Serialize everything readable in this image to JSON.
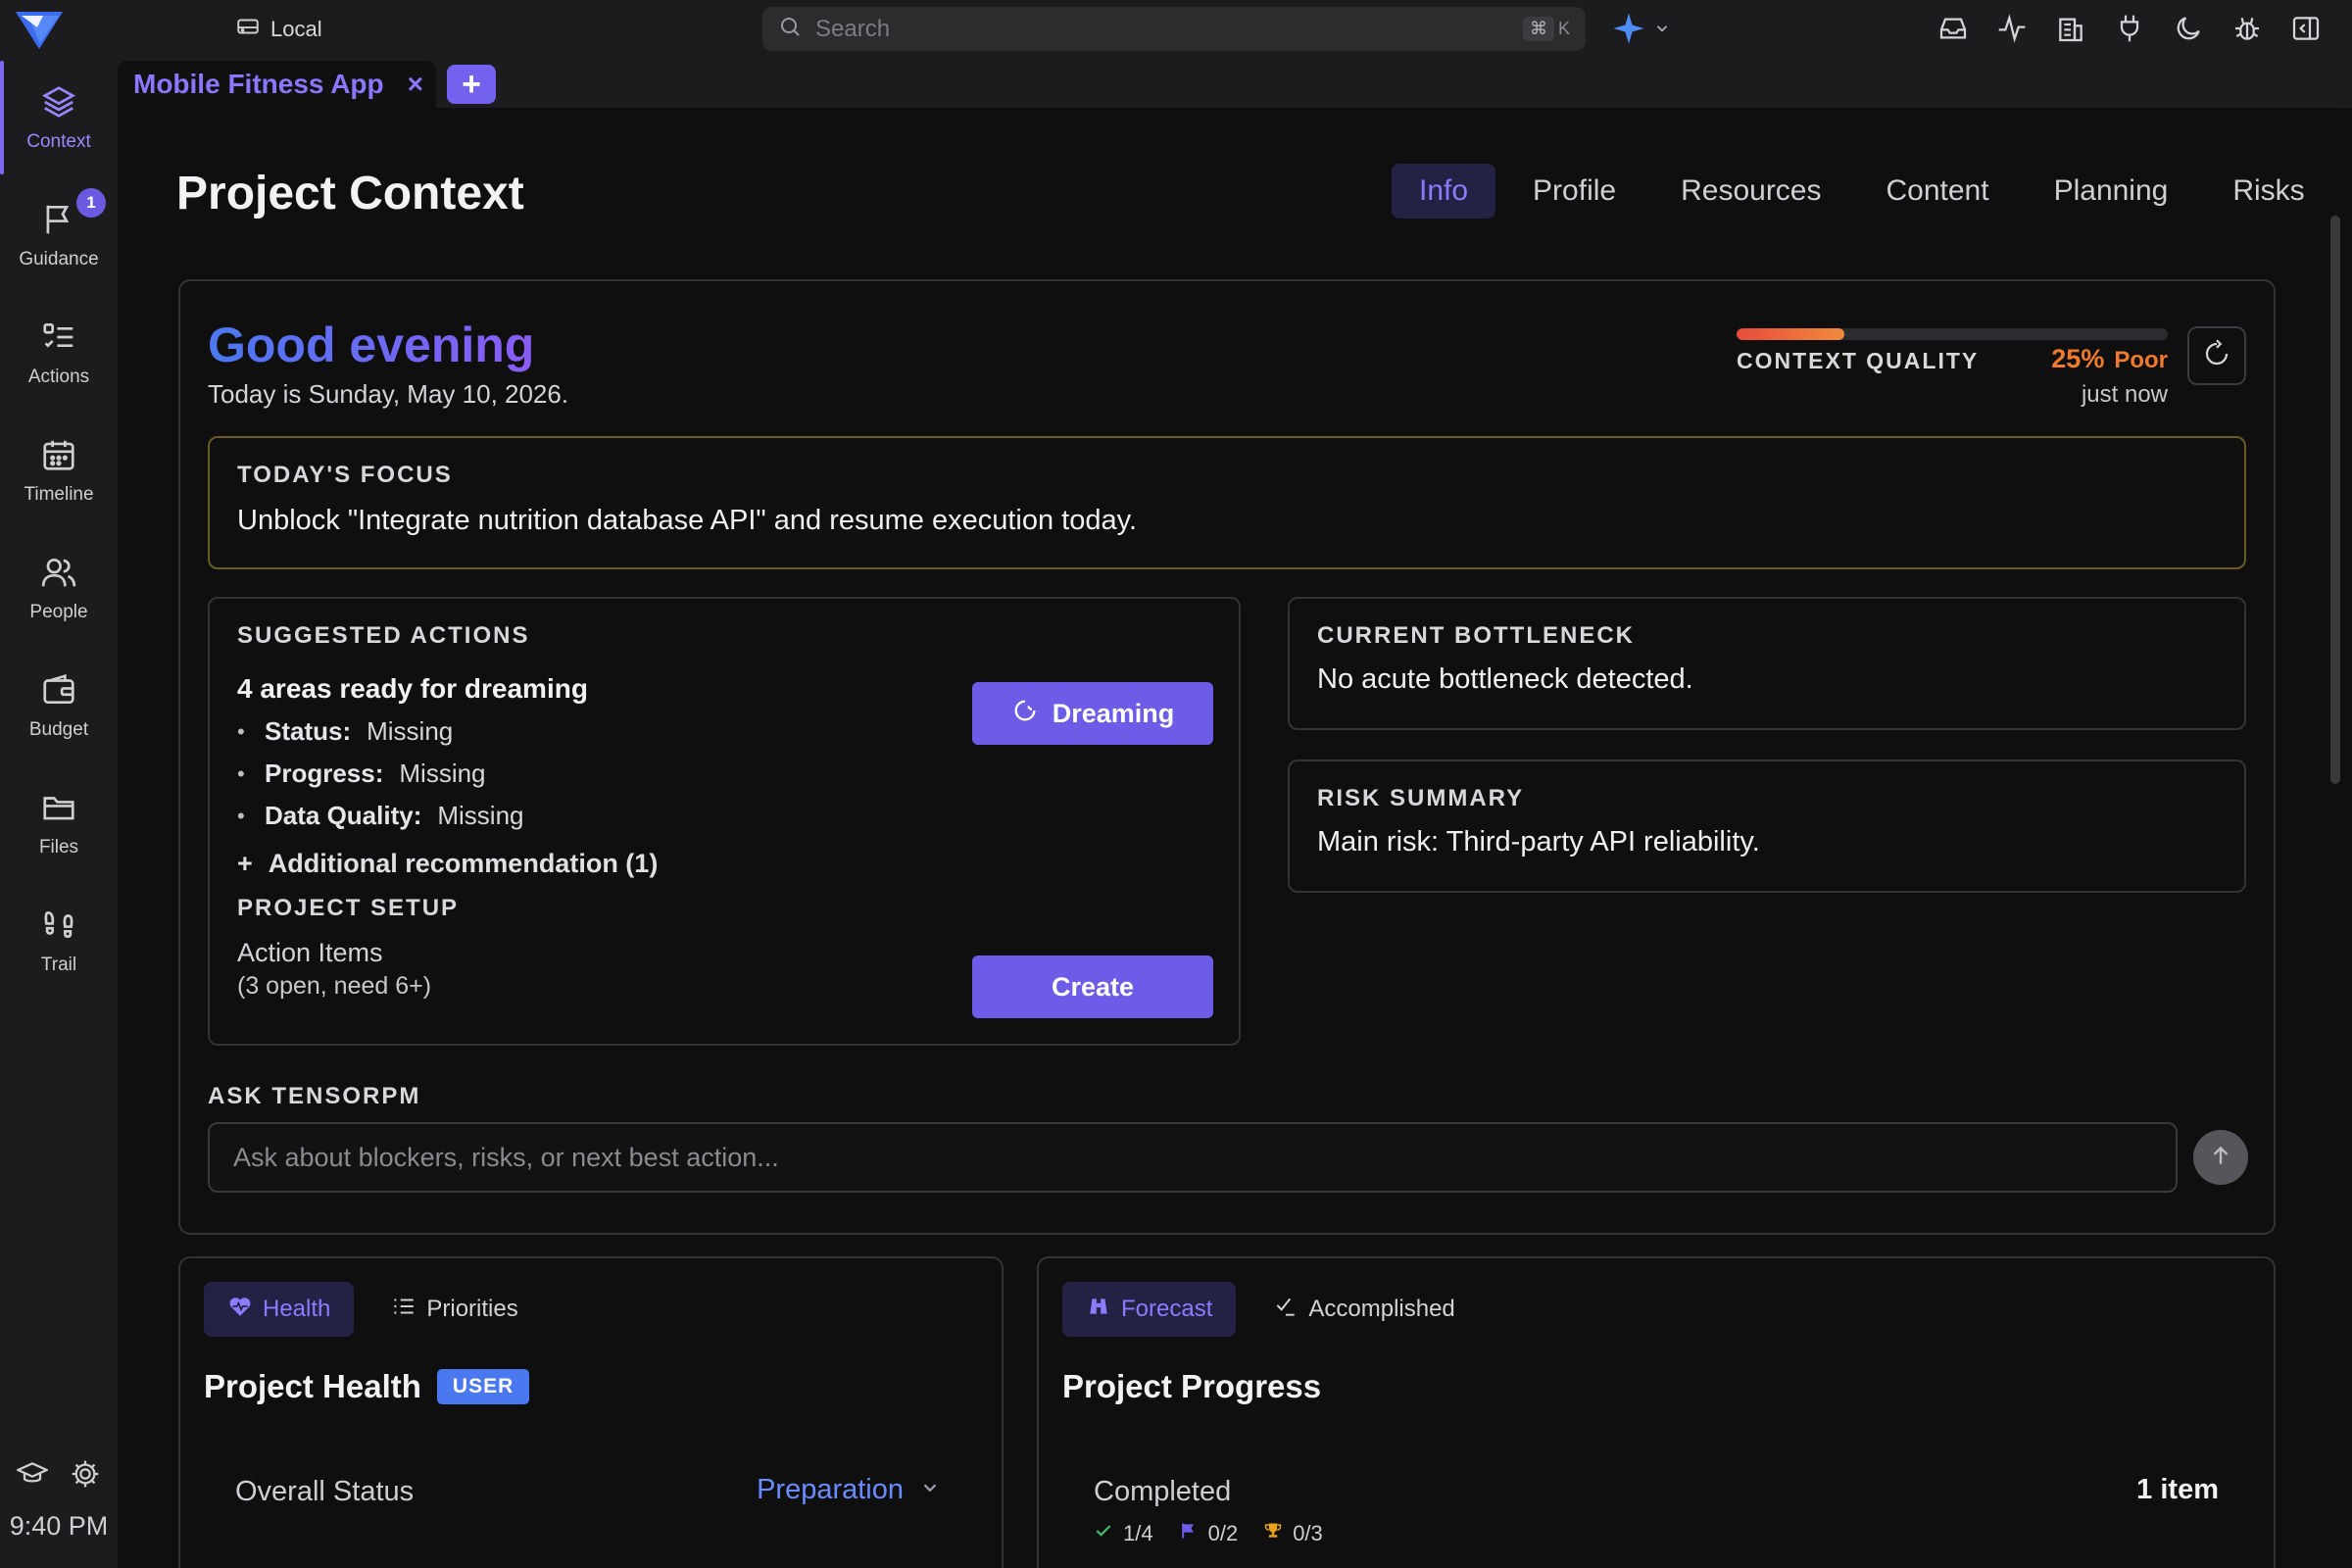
{
  "topbar": {
    "workspace": "Local",
    "search_placeholder": "Search",
    "shortcut_cmd": "⌘",
    "shortcut_key": "K"
  },
  "sidebar": {
    "items": [
      {
        "label": "Context",
        "icon": "layers-icon"
      },
      {
        "label": "Guidance",
        "icon": "flag-icon",
        "badge": "1"
      },
      {
        "label": "Actions",
        "icon": "checklist-icon"
      },
      {
        "label": "Timeline",
        "icon": "calendar-icon"
      },
      {
        "label": "People",
        "icon": "users-icon"
      },
      {
        "label": "Budget",
        "icon": "wallet-icon"
      },
      {
        "label": "Files",
        "icon": "folder-icon"
      },
      {
        "label": "Trail",
        "icon": "footprints-icon"
      }
    ],
    "time": "9:40 PM"
  },
  "tab": {
    "name": "Mobile Fitness App",
    "close": "×",
    "add": "+"
  },
  "header": {
    "title": "Project Context",
    "subtabs": [
      "Info",
      "Profile",
      "Resources",
      "Content",
      "Planning",
      "Risks"
    ]
  },
  "overview": {
    "greeting": "Good evening",
    "today": "Today is Sunday, May 10, 2026.",
    "context_quality": {
      "label": "CONTEXT QUALITY",
      "value": "25%",
      "level": 0.25,
      "rating": "Poor",
      "updated": "just now"
    },
    "focus": {
      "label": "TODAY'S FOCUS",
      "text": "Unblock \"Integrate nutrition database API\" and resume execution today."
    },
    "suggested": {
      "label": "SUGGESTED ACTIONS",
      "heading": "4 areas ready for dreaming",
      "items": [
        {
          "key": "Status:",
          "value": "Missing"
        },
        {
          "key": "Progress:",
          "value": "Missing"
        },
        {
          "key": "Data Quality:",
          "value": "Missing"
        }
      ],
      "dream_button": "Dreaming",
      "additional": "Additional recommendation (1)",
      "setup_label": "PROJECT SETUP",
      "setup_text": "Action Items",
      "setup_sub": "(3 open, need 6+)",
      "create_button": "Create"
    },
    "bottleneck": {
      "label": "CURRENT BOTTLENECK",
      "text": "No acute bottleneck detected."
    },
    "risk": {
      "label": "RISK SUMMARY",
      "text": "Main risk: Third-party API reliability."
    },
    "ask": {
      "label": "ASK TENSORPM",
      "placeholder": "Ask about blockers, risks, or next best action..."
    }
  },
  "health": {
    "tabs": [
      "Health",
      "Priorities"
    ],
    "title": "Project Health",
    "badge": "USER",
    "status_label": "Overall Status",
    "status_value": "Preparation"
  },
  "progress": {
    "tabs": [
      "Forecast",
      "Accomplished"
    ],
    "title": "Project Progress",
    "completed_label": "Completed",
    "completed_value": "1 item",
    "stats": [
      "1/4",
      "0/2",
      "0/3"
    ]
  },
  "colors": {
    "accent": "#6c5ce7",
    "accent_text": "#8a7cff",
    "quality_poor": "#f07a2c",
    "focus_border": "#6b5a22"
  }
}
